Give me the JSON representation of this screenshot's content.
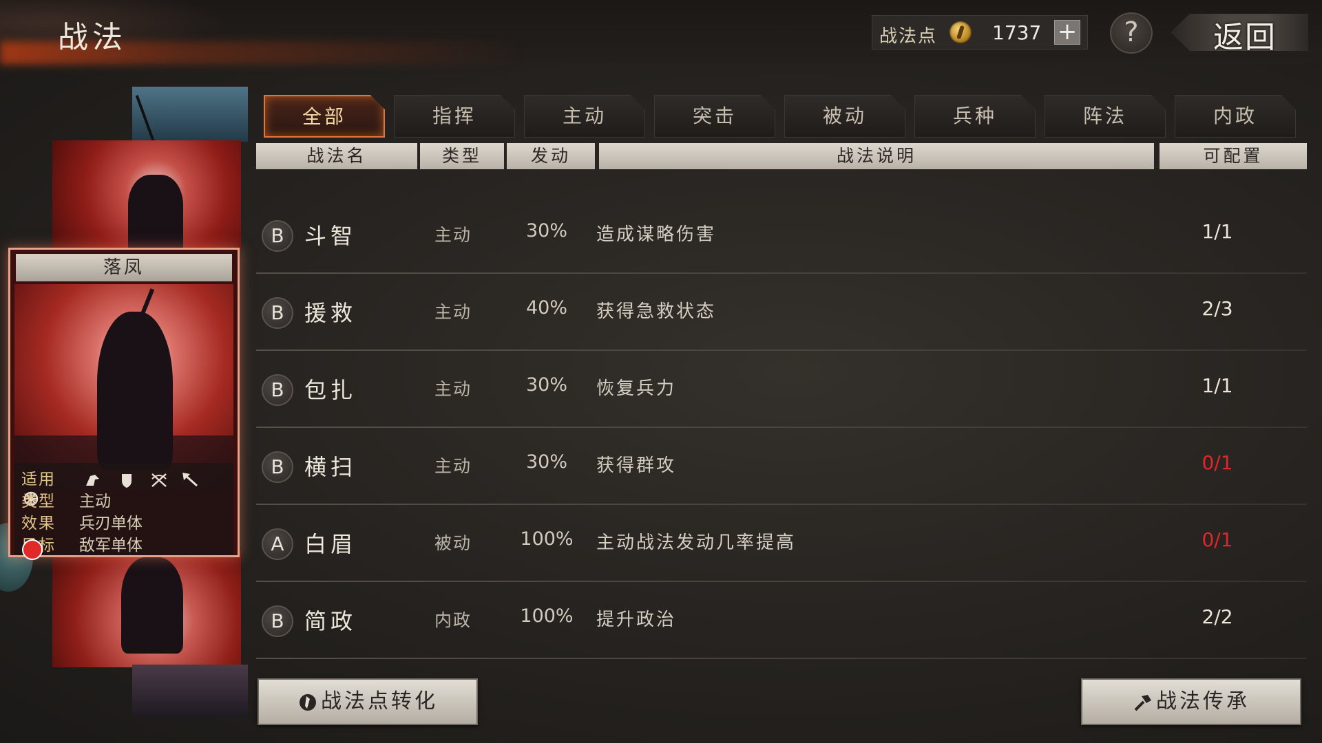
{
  "header": {
    "title": "战法",
    "points_label": "战法点",
    "points_value": "1737",
    "plus_label": "+",
    "help_label": "?",
    "back_label": "返回"
  },
  "card": {
    "name": "落凤",
    "rows": [
      {
        "key": "适用",
        "value": ""
      },
      {
        "key": "类型",
        "value": "主动"
      },
      {
        "key": "效果",
        "value": "兵刃单体"
      },
      {
        "key": "目标",
        "value": "敌军单体"
      }
    ],
    "troop_icons": [
      "cavalry-icon",
      "shield-icon",
      "bow-icon",
      "spear-icon",
      "wheel-icon"
    ]
  },
  "tabs": [
    "全部",
    "指挥",
    "主动",
    "突击",
    "被动",
    "兵种",
    "阵法",
    "内政"
  ],
  "active_tab": "全部",
  "columns": [
    "战法名",
    "类型",
    "发动",
    "战法说明",
    "可配置"
  ],
  "tactics": [
    {
      "grade": "B",
      "name": "斗智",
      "type": "主动",
      "rate": "30%",
      "desc": "造成谋略伤害",
      "count": "1/1",
      "available": true
    },
    {
      "grade": "B",
      "name": "援救",
      "type": "主动",
      "rate": "40%",
      "desc": "获得急救状态",
      "count": "2/3",
      "available": true
    },
    {
      "grade": "B",
      "name": "包扎",
      "type": "主动",
      "rate": "30%",
      "desc": "恢复兵力",
      "count": "1/1",
      "available": true
    },
    {
      "grade": "B",
      "name": "横扫",
      "type": "主动",
      "rate": "30%",
      "desc": "获得群攻",
      "count": "0/1",
      "available": false
    },
    {
      "grade": "A",
      "name": "白眉",
      "type": "被动",
      "rate": "100%",
      "desc": "主动战法发动几率提高",
      "count": "0/1",
      "available": false
    },
    {
      "grade": "B",
      "name": "简政",
      "type": "内政",
      "rate": "100%",
      "desc": "提升政治",
      "count": "2/2",
      "available": true
    }
  ],
  "buttons": {
    "convert": "战法点转化",
    "inherit": "战法传承"
  },
  "colors": {
    "accent": "#e2753c",
    "unavailable": "#e0262a"
  }
}
